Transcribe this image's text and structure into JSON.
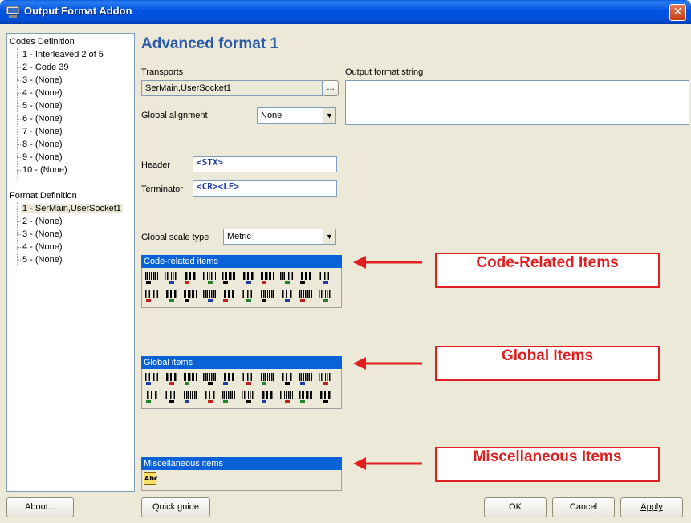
{
  "window": {
    "title": "Output Format Addon",
    "close_glyph": "✕"
  },
  "tree": {
    "codes_root": "Codes Definition",
    "codes": [
      "1 - Interleaved 2 of 5",
      "2 - Code 39",
      "3 - (None)",
      "4 - (None)",
      "5 - (None)",
      "6 - (None)",
      "7 - (None)",
      "8 - (None)",
      "9 - (None)",
      "10 - (None)"
    ],
    "format_root": "Format Definition",
    "formats": [
      "1 - SerMain,UserSocket1",
      "2 - (None)",
      "3 - (None)",
      "4 - (None)",
      "5 - (None)"
    ],
    "selected_format_index": 0
  },
  "main": {
    "heading": "Advanced format 1",
    "transports_label": "Transports",
    "transports_value": "SerMain,UserSocket1",
    "transports_browse": "...",
    "output_format_label": "Output format string",
    "output_format_value": "",
    "global_alignment_label": "Global alignment",
    "global_alignment_value": "None",
    "header_label": "Header",
    "header_value": "<STX>",
    "terminator_label": "Terminator",
    "terminator_value": "<CR><LF>",
    "global_scale_label": "Global scale type",
    "global_scale_value": "Metric",
    "dropdown_glyph": "▼"
  },
  "groups": {
    "code_related": {
      "title": "Code-related items",
      "icon_count": 20
    },
    "global": {
      "title": "Global items",
      "icon_count": 20
    },
    "misc": {
      "title": "Miscellaneous items",
      "icon_label": "Abc"
    }
  },
  "callouts": {
    "code_related": "Code-Related Items",
    "global": "Global Items",
    "misc": "Miscellaneous Items"
  },
  "buttons": {
    "about": "About...",
    "quick_guide": "Quick guide",
    "ok": "OK",
    "cancel": "Cancel",
    "apply": "Apply"
  },
  "colors": {
    "titlebar": "#0054e3",
    "heading": "#2b5aa8",
    "group_header": "#0a62d8",
    "callout": "#e02020",
    "code_text": "#1e3ba8"
  }
}
